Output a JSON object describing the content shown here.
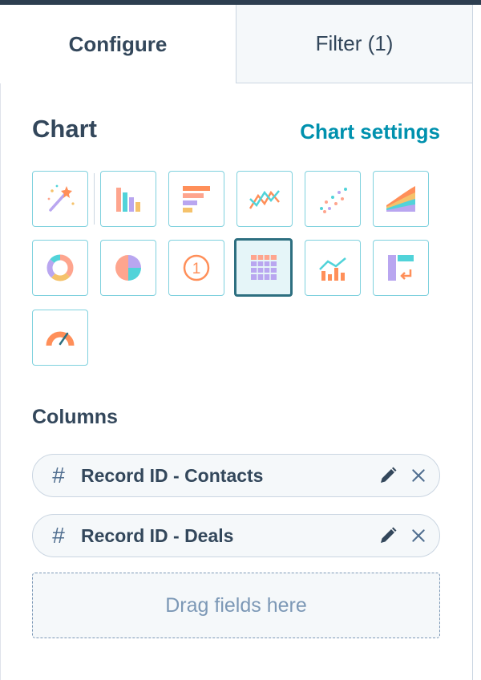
{
  "tabs": {
    "configure": "Configure",
    "filter": "Filter (1)",
    "active": "configure"
  },
  "chart": {
    "title": "Chart",
    "settings_link": "Chart settings",
    "types": [
      {
        "name": "magic-wand",
        "selected": false
      },
      {
        "name": "vertical-bar",
        "selected": false
      },
      {
        "name": "horizontal-bar",
        "selected": false
      },
      {
        "name": "line",
        "selected": false
      },
      {
        "name": "scatter",
        "selected": false
      },
      {
        "name": "area",
        "selected": false
      },
      {
        "name": "donut",
        "selected": false
      },
      {
        "name": "pie",
        "selected": false
      },
      {
        "name": "kpi",
        "selected": false
      },
      {
        "name": "table",
        "selected": true
      },
      {
        "name": "combo",
        "selected": false
      },
      {
        "name": "pivot-table",
        "selected": false
      },
      {
        "name": "gauge",
        "selected": false
      }
    ]
  },
  "kpi_icon_text": "1",
  "columns": {
    "title": "Columns",
    "fields": [
      {
        "hash": "#",
        "label": "Record ID - Contacts"
      },
      {
        "hash": "#",
        "label": "Record ID - Deals"
      }
    ],
    "dropzone": "Drag fields here"
  },
  "colors": {
    "accent_teal": "#0091ae",
    "tile_border": "#7fd1de",
    "selected_border": "#2d6f80",
    "text_dark": "#33475b",
    "coral": "#ff8f59",
    "peach": "#fea58e",
    "yellow": "#f5c26b",
    "teal": "#51d3d9",
    "purple": "#b9a6f0"
  }
}
